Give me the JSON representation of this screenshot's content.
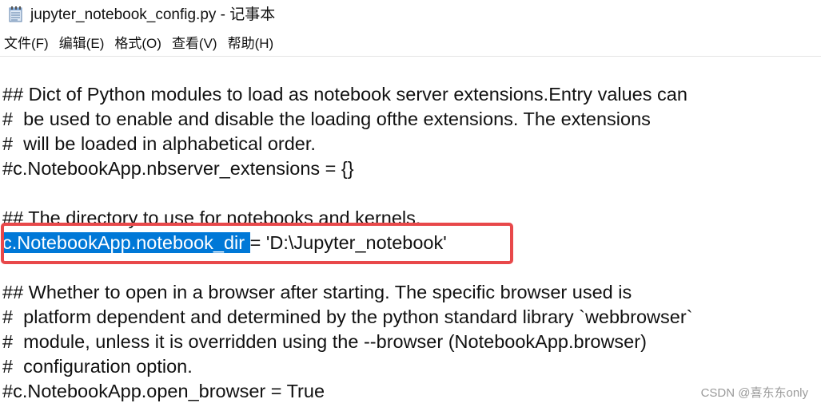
{
  "window": {
    "title": "jupyter_notebook_config.py - 记事本",
    "icon": "notepad-icon"
  },
  "menu": {
    "items": [
      {
        "label": "文件(F)"
      },
      {
        "label": "编辑(E)"
      },
      {
        "label": "格式(O)"
      },
      {
        "label": "查看(V)"
      },
      {
        "label": "帮助(H)"
      }
    ]
  },
  "editor": {
    "lines": [
      "## Dict of Python modules to load as notebook server extensions.Entry values can",
      "#  be used to enable and disable the loading ofthe extensions. The extensions",
      "#  will be loaded in alphabetical order.",
      "#c.NotebookApp.nbserver_extensions = {}",
      "",
      "## The directory to use for notebooks and kernels.",
      "",
      "",
      "## Whether to open in a browser after starting. The specific browser used is",
      "#  platform dependent and determined by the python standard library `webbrowser`",
      "#  module, unless it is overridden using the --browser (NotebookApp.browser)",
      "#  configuration option.",
      "#c.NotebookApp.open_browser = True"
    ],
    "highlighted_line": {
      "selected_text": "c.NotebookApp.notebook_dir ",
      "rest_text": "= 'D:\\Jupyter_notebook'"
    },
    "selection_color": "#0078d7",
    "annotation_color": "#e8484a"
  },
  "watermark": {
    "text": "CSDN @喜东东only"
  }
}
